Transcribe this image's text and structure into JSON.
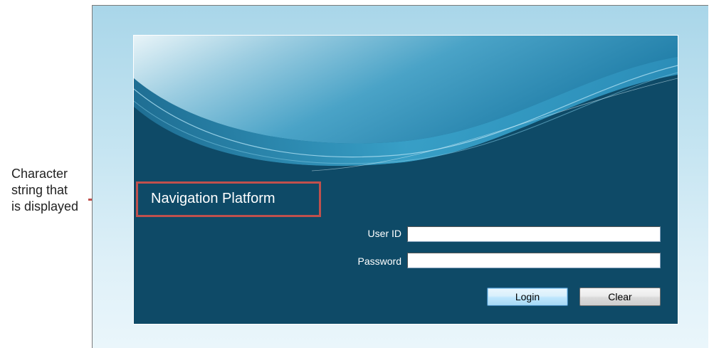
{
  "annotation": {
    "lines": [
      "Character",
      "string that",
      "is displayed"
    ],
    "accent_color": "#c0504d"
  },
  "login": {
    "title": "Navigation Platform",
    "user_id_label": "User ID",
    "user_id_value": "",
    "password_label": "Password",
    "password_value": "",
    "login_button": "Login",
    "clear_button": "Clear",
    "panel_color": "#0c425d"
  }
}
